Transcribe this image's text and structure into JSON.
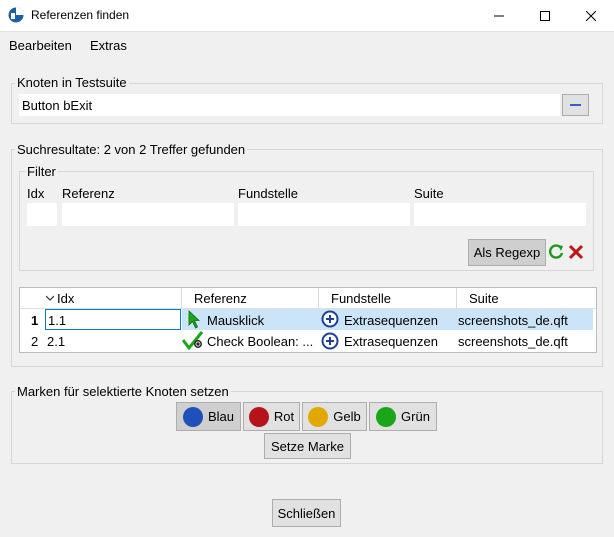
{
  "window": {
    "title": "Referenzen finden"
  },
  "menu": {
    "bearbeiten": "Bearbeiten",
    "extras": "Extras"
  },
  "knoten": {
    "label": "Knoten in Testsuite",
    "value": "Button bExit"
  },
  "results": {
    "label": "Suchresultate: 2 von 2 Treffer gefunden",
    "filter_label": "Filter",
    "filter_cols": [
      "Idx",
      "Referenz",
      "Fundstelle",
      "Suite"
    ],
    "regexp_label": "Als Regexp",
    "columns": [
      "Idx",
      "Referenz",
      "Fundstelle",
      "Suite"
    ],
    "rows": [
      {
        "num": "1",
        "idx": "1.1",
        "referenz": "Mausklick",
        "fundstelle": "Extrasequenzen",
        "suite": "screenshots_de.qft"
      },
      {
        "num": "2",
        "idx": "2.1",
        "referenz": "Check Boolean: ...",
        "fundstelle": "Extrasequenzen",
        "suite": "screenshots_de.qft"
      }
    ]
  },
  "marks": {
    "label": "Marken für selektierte Knoten setzen",
    "blau": "Blau",
    "rot": "Rot",
    "gelb": "Gelb",
    "gruen": "Grün",
    "setze": "Setze Marke",
    "colors": {
      "blau": "#1f4fb8",
      "rot": "#b5141b",
      "gelb": "#e0a800",
      "gruen": "#1aa51a"
    }
  },
  "close_label": "Schließen"
}
